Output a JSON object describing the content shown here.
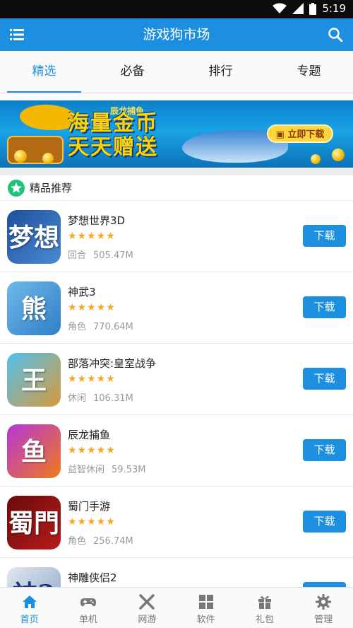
{
  "status_bar": {
    "time": "5:19",
    "wifi_icon": "wifi-icon"
  },
  "app_bar": {
    "title": "游戏狗市场",
    "menu_icon": "menu-icon",
    "search_icon": "search-icon"
  },
  "tabs": [
    {
      "label": "精选",
      "active": true
    },
    {
      "label": "必备",
      "active": false
    },
    {
      "label": "排行",
      "active": false
    },
    {
      "label": "专题",
      "active": false
    }
  ],
  "banner": {
    "brand": "辰龙捕鱼",
    "headline_line1": "海量金币",
    "headline_line2": "天天赠送",
    "button_label": "立即下载"
  },
  "section": {
    "title": "精品推荐",
    "icon": "star-icon"
  },
  "download_label": "下载",
  "apps": [
    {
      "name": "梦想世界3D",
      "stars": "★★★★★",
      "category": "回合",
      "size": "505.47M",
      "icon_glyph": "梦想",
      "icon_color": "#2b5fae"
    },
    {
      "name": "神武3",
      "stars": "★★★★★",
      "category": "角色",
      "size": "770.64M",
      "icon_glyph": "熊",
      "icon_color": "#5aa7e0"
    },
    {
      "name": "部落冲突:皇室战争",
      "stars": "★★★★★",
      "category": "休闲",
      "size": "106.31M",
      "icon_glyph": "王",
      "icon_color": "#3aa0d6"
    },
    {
      "name": "辰龙捕鱼",
      "stars": "★★★★★",
      "category": "益智休闲",
      "size": "59.53M",
      "icon_glyph": "鱼",
      "icon_color": "#8e2bbf"
    },
    {
      "name": "蜀门手游",
      "stars": "★★★★★",
      "category": "角色",
      "size": "256.74M",
      "icon_glyph": "蜀門",
      "icon_color": "#8a1010"
    },
    {
      "name": "神雕侠侣2",
      "stars": "★★★★★",
      "category": "",
      "size": "",
      "icon_glyph": "神2",
      "icon_color": "#c9d6e8"
    }
  ],
  "bottom_nav": [
    {
      "label": "首页",
      "icon": "home-icon",
      "active": true
    },
    {
      "label": "单机",
      "icon": "gamepad-icon",
      "active": false
    },
    {
      "label": "网游",
      "icon": "crossed-swords-icon",
      "active": false
    },
    {
      "label": "软件",
      "icon": "grid-icon",
      "active": false
    },
    {
      "label": "礼包",
      "icon": "gift-icon",
      "active": false
    },
    {
      "label": "管理",
      "icon": "gear-icon",
      "active": false
    }
  ],
  "colors": {
    "primary": "#1d8fe1",
    "star": "#f5a623",
    "section_icon": "#1ec478"
  }
}
